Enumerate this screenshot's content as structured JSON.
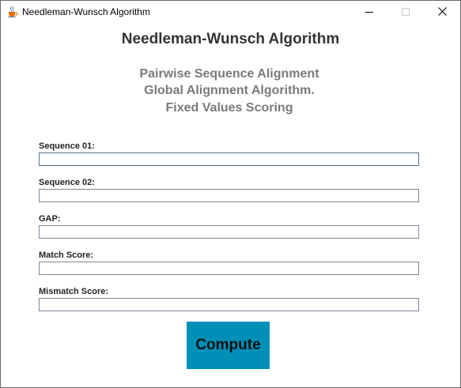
{
  "window": {
    "title": "Needleman-Wunsch Algorithm",
    "icon": "java-coffee-cup-icon",
    "controls": [
      "minimize-icon",
      "maximize-icon",
      "close-icon"
    ]
  },
  "header": {
    "title": "Needleman-Wunsch Algorithm",
    "subtitle_lines": [
      "Pairwise Sequence Alignment",
      "Global Alignment Algorithm.",
      "Fixed Values Scoring"
    ]
  },
  "form": {
    "fields": [
      {
        "label": "Sequence 01:",
        "value": ""
      },
      {
        "label": "Sequence 02:",
        "value": ""
      },
      {
        "label": "GAP:",
        "value": ""
      },
      {
        "label": "Match Score:",
        "value": ""
      },
      {
        "label": "Mismatch Score:",
        "value": ""
      }
    ],
    "submit_label": "Compute"
  },
  "colors": {
    "button_background": "#008fb7",
    "heading_text": "#333333",
    "subtitle_text": "#7a7a7a"
  }
}
